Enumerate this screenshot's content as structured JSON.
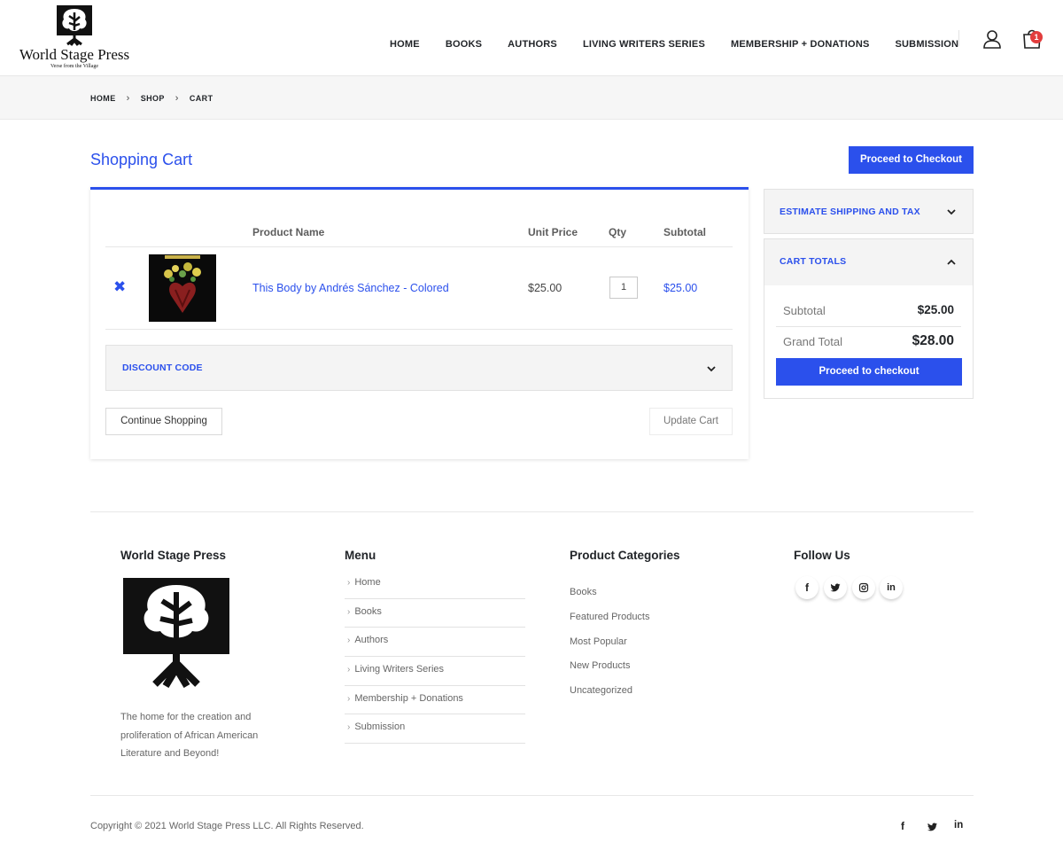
{
  "brand": {
    "name": "World Stage Press",
    "tagline": "Verse from the Village"
  },
  "nav": {
    "items": [
      "HOME",
      "BOOKS",
      "AUTHORS",
      "LIVING WRITERS SERIES",
      "MEMBERSHIP + DONATIONS",
      "SUBMISSION"
    ],
    "cart_count": "1"
  },
  "breadcrumb": {
    "items": [
      "HOME",
      "SHOP",
      "CART"
    ]
  },
  "cart": {
    "title": "Shopping Cart",
    "checkout_top_label": "Proceed to Checkout",
    "columns": {
      "product_name": "Product Name",
      "unit_price": "Unit Price",
      "qty": "Qty",
      "subtotal": "Subtotal"
    },
    "items": [
      {
        "name": "This Body by Andrés Sánchez - Colored",
        "unit_price": "$25.00",
        "qty": "1",
        "subtotal": "$25.00"
      }
    ],
    "discount_label": "DISCOUNT CODE",
    "continue_label": "Continue Shopping",
    "update_label": "Update Cart"
  },
  "sidebar": {
    "shipping_label": "ESTIMATE SHIPPING AND TAX",
    "totals_label": "CART TOTALS",
    "subtotal_label": "Subtotal",
    "subtotal_value": "$25.00",
    "grand_total_label": "Grand Total",
    "grand_total_value": "$28.00",
    "checkout_label": "Proceed to checkout"
  },
  "footer": {
    "about": {
      "heading": "World Stage Press",
      "text": "The home for the creation and proliferation of African American Literature and Beyond!"
    },
    "menu": {
      "heading": "Menu",
      "items": [
        "Home",
        "Books",
        "Authors",
        "Living Writers Series",
        "Membership + Donations",
        "Submission"
      ]
    },
    "categories": {
      "heading": "Product Categories",
      "items": [
        "Books",
        "Featured Products",
        "Most Popular",
        "New Products",
        "Uncategorized"
      ]
    },
    "follow": {
      "heading": "Follow Us",
      "icons": [
        "facebook-icon",
        "twitter-icon",
        "instagram-icon",
        "linkedin-icon"
      ]
    },
    "copyright": "Copyright © 2021 World Stage Press LLC. All Rights Reserved."
  },
  "colors": {
    "accent": "#2b50ec",
    "badge": "#e23d3d"
  }
}
